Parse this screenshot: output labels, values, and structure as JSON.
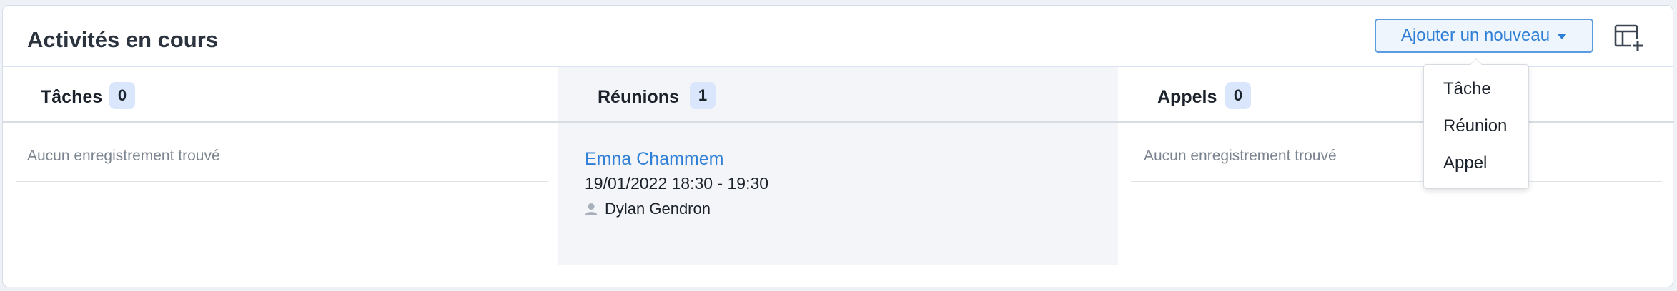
{
  "panel": {
    "title": "Activités en cours",
    "add_button_label": "Ajouter un nouveau"
  },
  "columns": [
    {
      "title": "Tâches",
      "count": "0",
      "empty_text": "Aucun enregistrement trouvé"
    },
    {
      "title": "Réunions",
      "count": "1",
      "records": [
        {
          "name": "Emna Chammem",
          "datetime": "19/01/2022 18:30 - 19:30",
          "assigned_user": "Dylan Gendron"
        }
      ]
    },
    {
      "title": "Appels",
      "count": "0",
      "empty_text": "Aucun enregistrement trouvé"
    }
  ],
  "dropdown": {
    "items": [
      "Tâche",
      "Réunion",
      "Appel"
    ]
  },
  "icons": {
    "layout": "layout-add-icon",
    "user": "user-icon",
    "caret": "caret-down-icon"
  },
  "colors": {
    "accent": "#2f7fd6",
    "badge": "#d9e6fb",
    "active_column": "#f4f5f8"
  }
}
